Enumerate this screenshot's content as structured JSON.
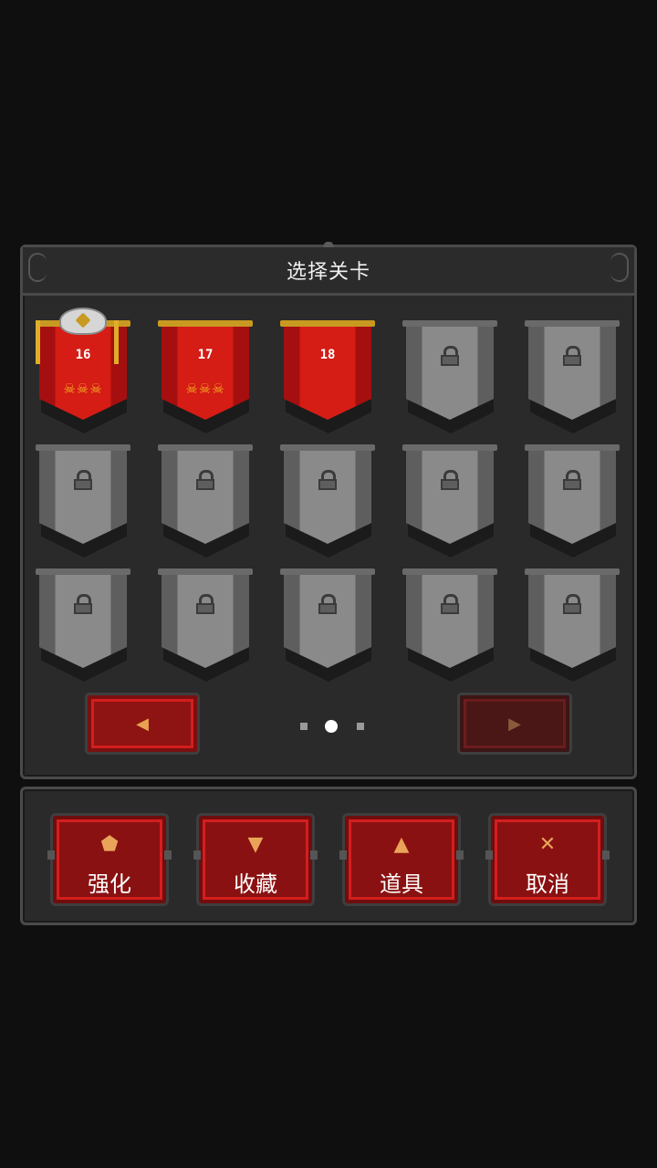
{
  "title": "选择关卡",
  "levels": [
    {
      "number": "16",
      "state": "cleared",
      "skulls": "☠☠☠",
      "crowned": true
    },
    {
      "number": "17",
      "state": "cleared",
      "skulls": "☠☠☠",
      "crowned": false
    },
    {
      "number": "18",
      "state": "unlocked",
      "skulls": "",
      "crowned": false
    },
    {
      "number": "",
      "state": "locked"
    },
    {
      "number": "",
      "state": "locked"
    },
    {
      "number": "",
      "state": "locked"
    },
    {
      "number": "",
      "state": "locked"
    },
    {
      "number": "",
      "state": "locked"
    },
    {
      "number": "",
      "state": "locked"
    },
    {
      "number": "",
      "state": "locked"
    },
    {
      "number": "",
      "state": "locked"
    },
    {
      "number": "",
      "state": "locked"
    },
    {
      "number": "",
      "state": "locked"
    },
    {
      "number": "",
      "state": "locked"
    },
    {
      "number": "",
      "state": "locked"
    }
  ],
  "pager": {
    "prev_icon": "◀",
    "next_icon": "▶",
    "pages": 3,
    "current_page": 2,
    "next_enabled": false
  },
  "actions": [
    {
      "label": "强化",
      "icon": "⬟",
      "icon_name": "upgrade-icon"
    },
    {
      "label": "收藏",
      "icon": "▼",
      "icon_name": "chalice-icon"
    },
    {
      "label": "道具",
      "icon": "▲",
      "icon_name": "potion-icon"
    },
    {
      "label": "取消",
      "icon": "✕",
      "icon_name": "close-icon"
    }
  ],
  "colors": {
    "background": "#0f0f0f",
    "panel": "#2a2a2a",
    "banner_red": "#d51c15",
    "banner_locked": "#8a8a8a",
    "gold": "#c99a21",
    "button_red": "#8a1111"
  }
}
